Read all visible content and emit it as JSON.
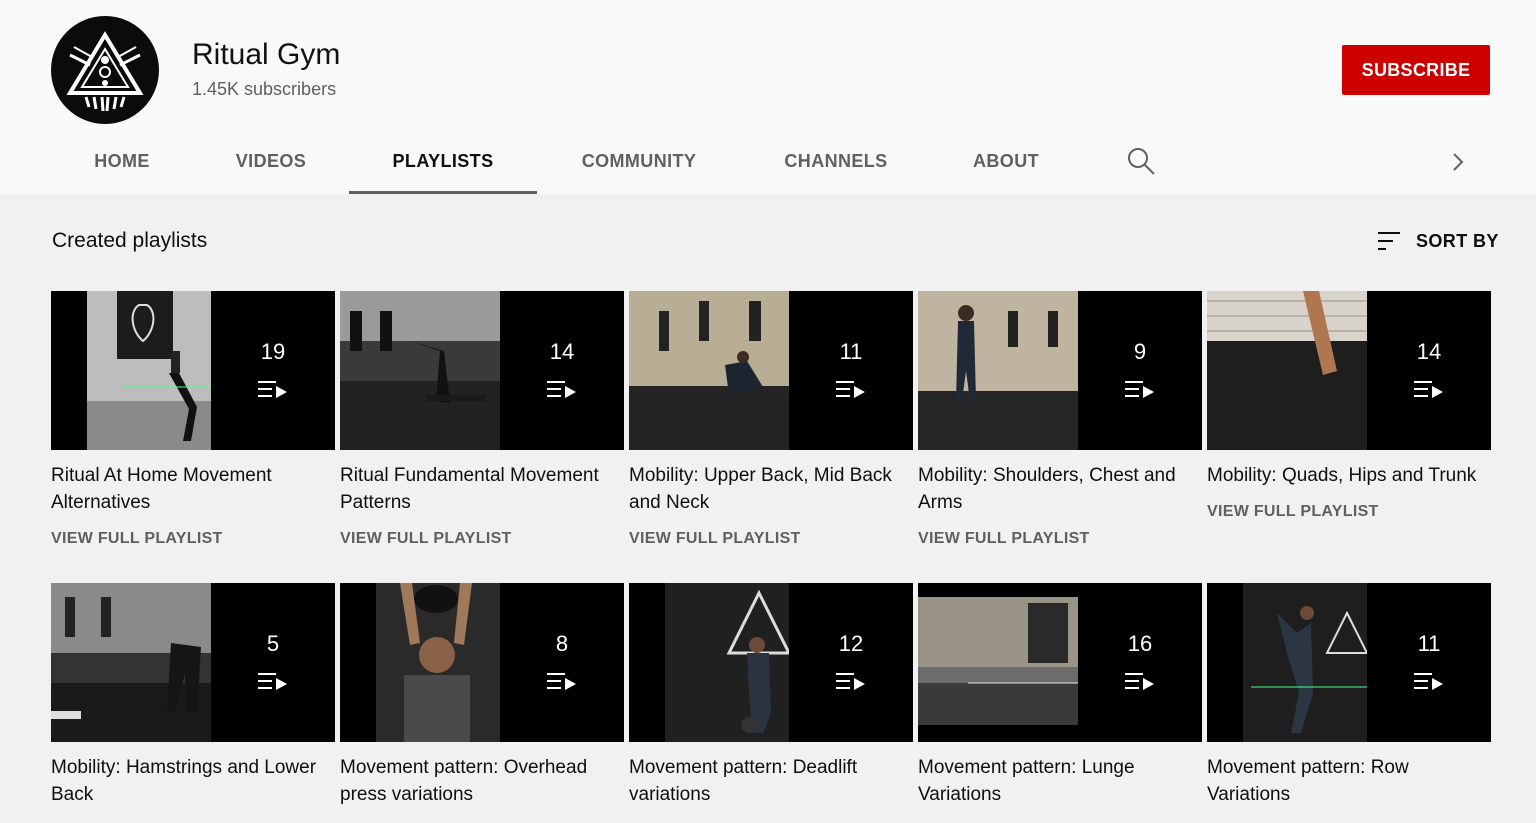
{
  "channel": {
    "name": "Ritual Gym",
    "subscribers": "1.45K subscribers",
    "subscribe_label": "SUBSCRIBE"
  },
  "tabs": [
    {
      "label": "HOME"
    },
    {
      "label": "VIDEOS"
    },
    {
      "label": "PLAYLISTS",
      "active": true
    },
    {
      "label": "COMMUNITY"
    },
    {
      "label": "CHANNELS"
    },
    {
      "label": "ABOUT"
    }
  ],
  "icons": {
    "search": "search-icon",
    "next": "chevron-right-icon",
    "sort": "sort-icon",
    "playlist": "playlist-play-icon"
  },
  "section": {
    "title": "Created playlists",
    "sort_label": "SORT BY"
  },
  "playlists": [
    {
      "title": "Ritual At Home Movement Alternatives",
      "count": "19",
      "link": "VIEW FULL PLAYLIST"
    },
    {
      "title": "Ritual Fundamental Movement Patterns",
      "count": "14",
      "link": "VIEW FULL PLAYLIST"
    },
    {
      "title": "Mobility: Upper Back, Mid Back and Neck",
      "count": "11",
      "link": "VIEW FULL PLAYLIST"
    },
    {
      "title": "Mobility: Shoulders, Chest and Arms",
      "count": "9",
      "link": "VIEW FULL PLAYLIST"
    },
    {
      "title": "Mobility: Quads, Hips and Trunk",
      "count": "14",
      "link": "VIEW FULL PLAYLIST"
    },
    {
      "title": "Mobility: Hamstrings and Lower Back",
      "count": "5"
    },
    {
      "title": "Movement pattern: Overhead press variations",
      "count": "8"
    },
    {
      "title": "Movement pattern: Deadlift variations",
      "count": "12"
    },
    {
      "title": "Movement pattern: Lunge Variations",
      "count": "16"
    },
    {
      "title": "Movement pattern: Row Variations",
      "count": "11"
    }
  ],
  "colors": {
    "brand_red": "#cc0000",
    "background": "#f1f1f1",
    "header_bg": "#f9f9f9",
    "secondary_text": "#606060"
  }
}
